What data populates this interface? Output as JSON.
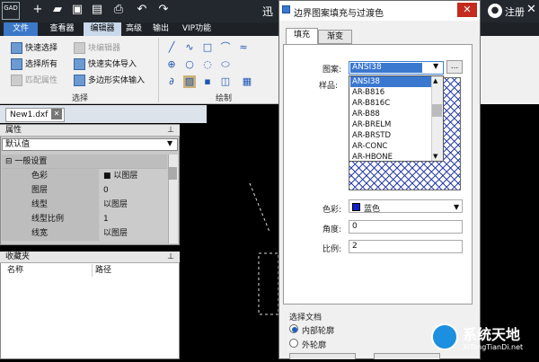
{
  "app": {
    "logo_text": "GAD",
    "title_partial": "迅",
    "register": "注册",
    "quick_icons": [
      "plus-icon",
      "folder-icon",
      "save-icon",
      "save-as-icon",
      "print-icon",
      "undo-icon",
      "redo-icon"
    ]
  },
  "menu": [
    "文件",
    "查看器",
    "编辑器",
    "高级",
    "输出",
    "VIP功能"
  ],
  "ribbon": {
    "select_group": {
      "items": [
        "快速选择",
        "选择所有",
        "匹配属性"
      ],
      "disabled": [
        false,
        false,
        true
      ],
      "label": "选择"
    },
    "block_group": {
      "items": [
        "块编辑器",
        "快速实体导入",
        "多边形实体输入"
      ],
      "disabled": [
        true,
        false,
        false
      ]
    },
    "draw_group": {
      "label": "绘制"
    }
  },
  "document": {
    "tab": "New1.dxf"
  },
  "properties": {
    "header": "属性",
    "selector": "默认值",
    "section": "一般设置",
    "rows": [
      {
        "key": "色彩",
        "value": "■ 以图层"
      },
      {
        "key": "图层",
        "value": "0"
      },
      {
        "key": "线型",
        "value": "以图层"
      },
      {
        "key": "线型比例",
        "value": "1"
      },
      {
        "key": "线宽",
        "value": "以图层"
      }
    ]
  },
  "favorites": {
    "header": "收藏夹",
    "columns": [
      "名称",
      "路径"
    ]
  },
  "dialog": {
    "title": "边界图案填充与过渡色",
    "tabs": [
      "填充",
      "渐变"
    ],
    "pattern_label": "图案:",
    "pattern_value": "ANSI38",
    "more_button": "...",
    "sample_label": "样品:",
    "pattern_options": [
      "ANSI38",
      "AR-B816",
      "AR-B816C",
      "AR-B88",
      "AR-BRELM",
      "AR-BRSTD",
      "AR-CONC",
      "AR-HBONE"
    ],
    "color_label": "色彩:",
    "color_value": "蓝色",
    "color_hex": "#1020c8",
    "angle_label": "角度:",
    "angle_value": "0",
    "scale_label": "比例:",
    "scale_value": "2",
    "boundary_section": "选择文档",
    "boundary_options": [
      "内部轮廓",
      "外轮廓"
    ],
    "boundary_selected": 0
  },
  "watermark": {
    "name": "系统天地",
    "url": "XiTongTianDi.net"
  }
}
